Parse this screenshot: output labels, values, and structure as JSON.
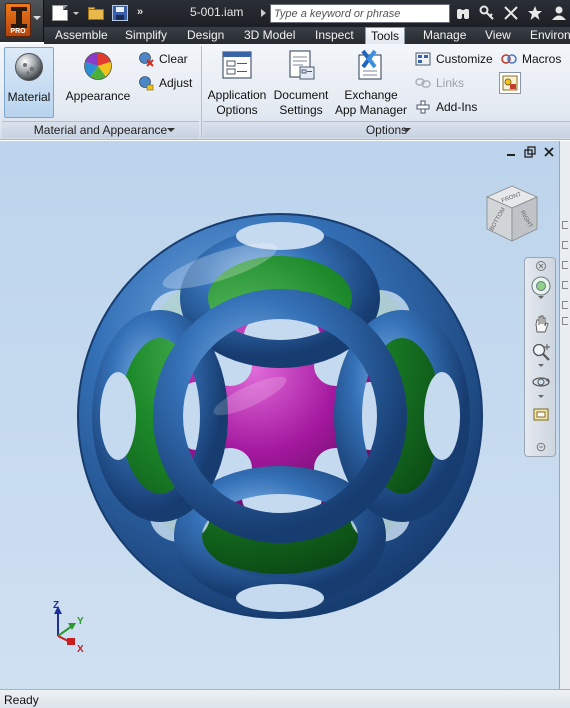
{
  "app": {
    "logo_badge": "PRO",
    "document_title": "5-001.iam"
  },
  "search": {
    "placeholder": "Type a keyword or phrase"
  },
  "quick_access": {
    "icons": [
      "new-icon",
      "open-icon",
      "save-icon",
      "more-icon"
    ],
    "more_label": "»"
  },
  "title_bar_icons": [
    "binoculars-icon",
    "key-icon",
    "x-tools-icon",
    "star-icon",
    "user-icon"
  ],
  "tabs": [
    {
      "label": "Assemble",
      "active": false
    },
    {
      "label": "Simplify",
      "active": false
    },
    {
      "label": "Design",
      "active": false
    },
    {
      "label": "3D Model",
      "active": false
    },
    {
      "label": "Inspect",
      "active": false
    },
    {
      "label": "Tools",
      "active": true
    },
    {
      "label": "Manage",
      "active": false
    },
    {
      "label": "View",
      "active": false
    },
    {
      "label": "Environ",
      "active": false
    }
  ],
  "ribbon": {
    "material_panel": {
      "title": "Material and Appearance",
      "material_label": "Material",
      "appearance_label": "Appearance",
      "clear_label": "Clear",
      "adjust_label": "Adjust"
    },
    "options_panel": {
      "title": "Options",
      "app_options_line1": "Application",
      "app_options_line2": "Options",
      "doc_settings_line1": "Document",
      "doc_settings_line2": "Settings",
      "exchange_line1": "Exchange",
      "exchange_line2": "App Manager",
      "customize_label": "Customize",
      "links_label": "Links",
      "addins_label": "Add-Ins",
      "macros_label": "Macros"
    }
  },
  "viewport": {
    "window_controls": [
      "minimize-icon",
      "restore-icon",
      "close-icon"
    ],
    "viewcube_faces": [
      "FRONT",
      "RIGHT",
      "BOTTOM"
    ],
    "model_colors": {
      "outer_sphere": "#2f66a8",
      "middle_sphere": "#1f8a2a",
      "inner_sphere": "#a3189e",
      "background": "#c6daef"
    },
    "triad": {
      "x": "X",
      "y": "Y",
      "z": "Z"
    }
  },
  "status": {
    "text": "Ready"
  }
}
